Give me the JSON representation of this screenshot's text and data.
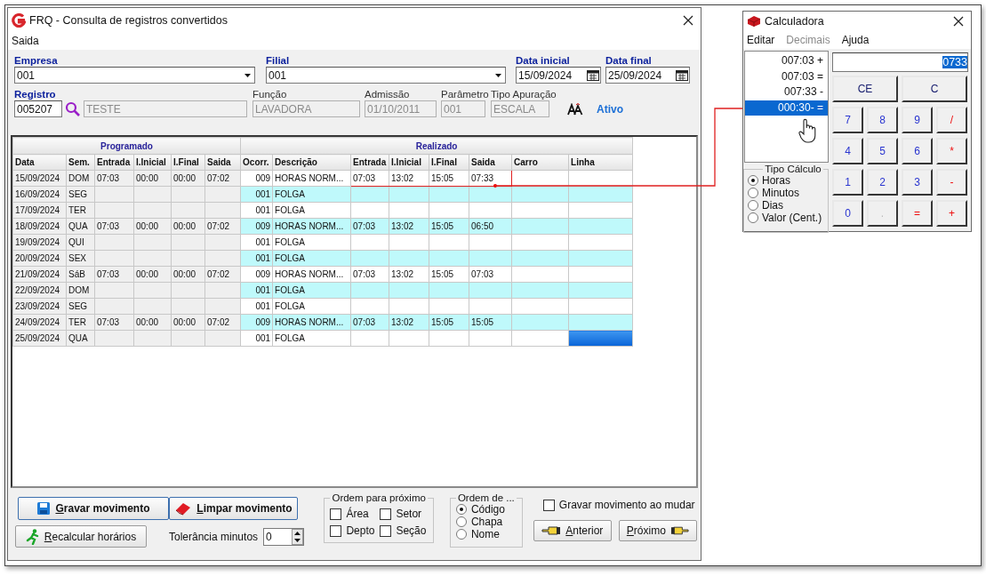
{
  "main_window": {
    "title": "FRQ - Consulta de registros convertidos",
    "menu": [
      "Saida"
    ],
    "form_rows": [
      [
        {
          "label": "Empresa",
          "required": true,
          "kind": "combo",
          "value": "001"
        },
        {
          "label": "Filial",
          "required": true,
          "kind": "combo",
          "value": "001"
        },
        {
          "label": "Data inicial",
          "required": true,
          "kind": "date",
          "value": "15/09/2024"
        },
        {
          "label": "Data final",
          "required": true,
          "kind": "date",
          "value": "25/09/2024"
        }
      ],
      [
        {
          "label": "Registro",
          "required": true,
          "kind": "lookup",
          "value": "005207"
        },
        {
          "kind": "readonly",
          "value": "TESTE"
        },
        {
          "label": "Função",
          "required": false,
          "kind": "readonly",
          "value": "LAVADORA"
        },
        {
          "label": "Admissão",
          "required": false,
          "kind": "readonly",
          "value": "01/10/2011"
        },
        {
          "label": "Parâmetro",
          "required": false,
          "kind": "readonly",
          "value": "001"
        },
        {
          "label": "Tipo Apuração",
          "required": false,
          "kind": "readonly",
          "value": "ESCALA"
        },
        {
          "kind": "status",
          "value": "Ativo"
        }
      ]
    ],
    "table": {
      "groups": [
        "Programado",
        "Realizado"
      ],
      "columns": [
        "Data",
        "Sem.",
        "Entrada",
        "I.Inicial",
        "I.Final",
        "Saida",
        "Ocorr.",
        "Descrição",
        "Entrada",
        "I.Inicial",
        "I.Final",
        "Saida",
        "Carro",
        "Linha"
      ],
      "rows": [
        {
          "shaded": false,
          "selected": false,
          "marked": true,
          "cells": [
            "15/09/2024",
            "DOM",
            "07:03",
            "00:00",
            "00:00",
            "07:02",
            "009",
            "HORAS NORM...",
            "07:03",
            "13:02",
            "15:05",
            "07:33",
            null,
            null
          ]
        },
        {
          "shaded": true,
          "selected": false,
          "marked": false,
          "cells": [
            "16/09/2024",
            "SEG",
            null,
            null,
            null,
            null,
            "001",
            "FOLGA",
            null,
            null,
            null,
            null,
            null,
            null
          ]
        },
        {
          "shaded": false,
          "selected": false,
          "marked": false,
          "cells": [
            "17/09/2024",
            "TER",
            null,
            null,
            null,
            null,
            "001",
            "FOLGA",
            null,
            null,
            null,
            null,
            null,
            null
          ]
        },
        {
          "shaded": true,
          "selected": false,
          "marked": false,
          "cells": [
            "18/09/2024",
            "QUA",
            "07:03",
            "00:00",
            "00:00",
            "07:02",
            "009",
            "HORAS NORM...",
            "07:03",
            "13:02",
            "15:05",
            "06:50",
            null,
            null
          ]
        },
        {
          "shaded": false,
          "selected": false,
          "marked": false,
          "cells": [
            "19/09/2024",
            "QUI",
            null,
            null,
            null,
            null,
            "001",
            "FOLGA",
            null,
            null,
            null,
            null,
            null,
            null
          ]
        },
        {
          "shaded": true,
          "selected": false,
          "marked": false,
          "cells": [
            "20/09/2024",
            "SEX",
            null,
            null,
            null,
            null,
            "001",
            "FOLGA",
            null,
            null,
            null,
            null,
            null,
            null
          ]
        },
        {
          "shaded": false,
          "selected": false,
          "marked": false,
          "cells": [
            "21/09/2024",
            "SáB",
            "07:03",
            "00:00",
            "00:00",
            "07:02",
            "009",
            "HORAS NORM...",
            "07:03",
            "13:02",
            "15:05",
            "07:03",
            null,
            null
          ]
        },
        {
          "shaded": true,
          "selected": false,
          "marked": false,
          "cells": [
            "22/09/2024",
            "DOM",
            null,
            null,
            null,
            null,
            "001",
            "FOLGA",
            null,
            null,
            null,
            null,
            null,
            null
          ]
        },
        {
          "shaded": false,
          "selected": false,
          "marked": false,
          "cells": [
            "23/09/2024",
            "SEG",
            null,
            null,
            null,
            null,
            "001",
            "FOLGA",
            null,
            null,
            null,
            null,
            null,
            null
          ]
        },
        {
          "shaded": true,
          "selected": false,
          "marked": false,
          "cells": [
            "24/09/2024",
            "TER",
            "07:03",
            "00:00",
            "00:00",
            "07:02",
            "009",
            "HORAS NORM...",
            "07:03",
            "13:02",
            "15:05",
            "15:05",
            null,
            null
          ]
        },
        {
          "shaded": false,
          "selected": true,
          "marked": false,
          "cells": [
            "25/09/2024",
            "QUA",
            null,
            null,
            null,
            null,
            "001",
            "FOLGA",
            null,
            null,
            null,
            null,
            null,
            null
          ]
        }
      ]
    },
    "buttons": {
      "save": "Gravar movimento",
      "clear": "Limpar movimento",
      "recalc": "Recalcular horários",
      "previous": "Anterior",
      "next": "Próximo"
    },
    "tolerance": {
      "label": "Tolerância minutos",
      "value": "0"
    },
    "order_next": {
      "title": "Ordem para próximo",
      "options": [
        {
          "label": "Área",
          "checked": false
        },
        {
          "label": "Setor",
          "checked": false
        },
        {
          "label": "Depto",
          "checked": false
        },
        {
          "label": "Seção",
          "checked": false
        }
      ]
    },
    "order_by": {
      "title": "Ordem de ...",
      "options": [
        {
          "label": "Código",
          "selected": true
        },
        {
          "label": "Chapa",
          "selected": false
        },
        {
          "label": "Nome",
          "selected": false
        }
      ]
    },
    "save_on_change": {
      "label": "Gravar movimento ao mudar",
      "checked": false
    }
  },
  "calculator": {
    "title": "Calculadora",
    "menu": [
      {
        "label": "Editar",
        "disabled": false
      },
      {
        "label": "Decimais",
        "disabled": true
      },
      {
        "label": "Ajuda",
        "disabled": false
      }
    ],
    "tape": [
      {
        "text": "007:03 +",
        "selected": false
      },
      {
        "text": "007:03 =",
        "selected": false
      },
      {
        "text": "007:33 -",
        "selected": false
      },
      {
        "text": "000:30- =",
        "selected": true
      }
    ],
    "display": {
      "value": "0733",
      "selected": true
    },
    "keys": [
      {
        "label": "CE",
        "kind": "clear",
        "disabled": false
      },
      {
        "label": "C",
        "kind": "clear",
        "disabled": false
      },
      {
        "label": "7",
        "kind": "digit",
        "disabled": false
      },
      {
        "label": "8",
        "kind": "digit",
        "disabled": false
      },
      {
        "label": "9",
        "kind": "digit",
        "disabled": false
      },
      {
        "label": "/",
        "kind": "operator",
        "disabled": false
      },
      {
        "label": "4",
        "kind": "digit",
        "disabled": false
      },
      {
        "label": "5",
        "kind": "digit",
        "disabled": false
      },
      {
        "label": "6",
        "kind": "digit",
        "disabled": false
      },
      {
        "label": "*",
        "kind": "operator",
        "disabled": false
      },
      {
        "label": "1",
        "kind": "digit",
        "disabled": false
      },
      {
        "label": "2",
        "kind": "digit",
        "disabled": false
      },
      {
        "label": "3",
        "kind": "digit",
        "disabled": false
      },
      {
        "label": "-",
        "kind": "operator",
        "disabled": false
      },
      {
        "label": "0",
        "kind": "digit",
        "disabled": false
      },
      {
        "label": ".",
        "kind": "digit",
        "disabled": true
      },
      {
        "label": "=",
        "kind": "operator",
        "disabled": false
      },
      {
        "label": "+",
        "kind": "operator",
        "disabled": false
      }
    ],
    "calc_type": {
      "title": "Tipo Cálculo",
      "options": [
        {
          "label": "Horas",
          "selected": true
        },
        {
          "label": "Minutos",
          "selected": false
        },
        {
          "label": "Dias",
          "selected": false
        },
        {
          "label": "Valor (Cent.)",
          "selected": false
        }
      ]
    }
  }
}
